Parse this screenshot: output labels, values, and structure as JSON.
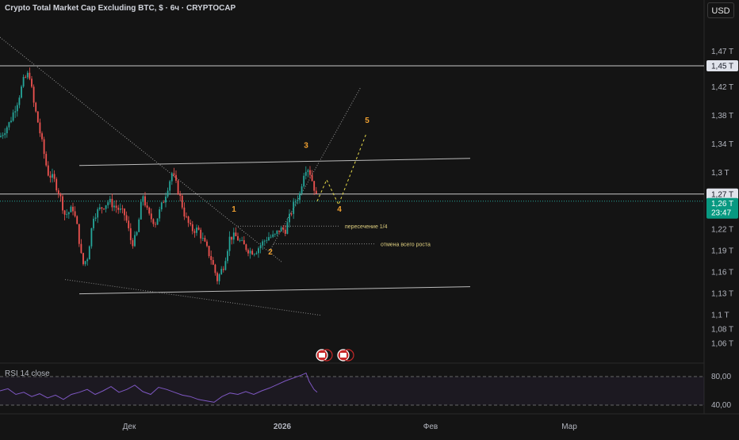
{
  "title": "Crypto Total Market Cap Excluding BTC, $ · 6ч · CRYPTOCAP",
  "currency": "USD",
  "rsi_label": "RSI 14 close",
  "price_badges": {
    "resistance": "1,45 T",
    "level": "1,27 T",
    "last": "1,26 T",
    "countdown": "23:47"
  },
  "annotations": {
    "intersection": "пересечение 1/4",
    "cancel": "отмена всего роста"
  },
  "colors": {
    "background": "#141414",
    "up": "#26a69a",
    "down": "#ef5350",
    "wave": "#f0a030",
    "rsi": "#7e57c2",
    "last_badge": "#089981"
  },
  "chart_data": {
    "type": "candlestick",
    "y_axis": {
      "unit": "T",
      "ylim": [
        1.035,
        1.5
      ],
      "ticks": [
        "1,47 T",
        "1,42 T",
        "1,38 T",
        "1,34 T",
        "1,3 T",
        "1,22 T",
        "1,19 T",
        "1,16 T",
        "1,13 T",
        "1,1 T",
        "1,08 T",
        "1,06 T"
      ],
      "tick_values": [
        1.47,
        1.42,
        1.38,
        1.34,
        1.3,
        1.22,
        1.19,
        1.16,
        1.13,
        1.1,
        1.08,
        1.06
      ]
    },
    "x_axis": {
      "labels": [
        "Дек",
        "2026",
        "Фев",
        "Мар"
      ]
    },
    "close_path": [
      [
        0,
        1.35
      ],
      [
        12,
        1.37
      ],
      [
        22,
        1.4
      ],
      [
        30,
        1.43
      ],
      [
        37,
        1.44
      ],
      [
        42,
        1.4
      ],
      [
        48,
        1.37
      ],
      [
        55,
        1.33
      ],
      [
        60,
        1.3
      ],
      [
        68,
        1.29
      ],
      [
        75,
        1.27
      ],
      [
        82,
        1.24
      ],
      [
        92,
        1.25
      ],
      [
        98,
        1.22
      ],
      [
        104,
        1.17
      ],
      [
        110,
        1.18
      ],
      [
        118,
        1.24
      ],
      [
        127,
        1.25
      ],
      [
        137,
        1.26
      ],
      [
        148,
        1.25
      ],
      [
        158,
        1.24
      ],
      [
        166,
        1.2
      ],
      [
        172,
        1.21
      ],
      [
        180,
        1.27
      ],
      [
        187,
        1.24
      ],
      [
        196,
        1.23
      ],
      [
        206,
        1.26
      ],
      [
        217,
        1.3
      ],
      [
        226,
        1.27
      ],
      [
        233,
        1.24
      ],
      [
        241,
        1.22
      ],
      [
        250,
        1.22
      ],
      [
        258,
        1.2
      ],
      [
        266,
        1.18
      ],
      [
        274,
        1.15
      ],
      [
        282,
        1.17
      ],
      [
        290,
        1.21
      ],
      [
        298,
        1.21
      ],
      [
        305,
        1.2
      ],
      [
        315,
        1.19
      ],
      [
        322,
        1.19
      ],
      [
        330,
        1.2
      ],
      [
        338,
        1.21
      ],
      [
        346,
        1.21
      ],
      [
        352,
        1.22
      ],
      [
        360,
        1.22
      ],
      [
        366,
        1.24
      ],
      [
        372,
        1.26
      ],
      [
        378,
        1.27
      ],
      [
        383,
        1.3
      ],
      [
        387,
        1.31
      ],
      [
        391,
        1.3
      ],
      [
        396,
        1.28
      ],
      [
        400,
        1.26
      ]
    ],
    "levels": {
      "resistance": 1.45,
      "current_level": 1.27,
      "last_price": 1.26,
      "intersection_1_4": 1.225,
      "cancel_all_growth": 1.2
    },
    "channel": {
      "upper": [
        [
          100,
          1.31
        ],
        [
          593,
          1.32
        ]
      ],
      "lower": [
        [
          100,
          1.13
        ],
        [
          593,
          1.14
        ]
      ],
      "lower_wick_line": [
        [
          82,
          1.15
        ],
        [
          404,
          1.1
        ]
      ]
    },
    "trend_lines": [
      {
        "points": [
          [
            0,
            1.49
          ],
          [
            355,
            1.175
          ]
        ],
        "style": "dotted"
      },
      {
        "points": [
          [
            340,
            1.19
          ],
          [
            455,
            1.42
          ]
        ],
        "style": "dotted"
      }
    ],
    "elliott_waves": [
      {
        "label": "1",
        "x": 295,
        "y": 1.245
      },
      {
        "label": "2",
        "x": 341,
        "y": 1.185
      },
      {
        "label": "3",
        "x": 386,
        "y": 1.335
      },
      {
        "label": "4",
        "x": 428,
        "y": 1.245
      },
      {
        "label": "5",
        "x": 463,
        "y": 1.37
      }
    ],
    "projection_path": [
      [
        400,
        1.26
      ],
      [
        412,
        1.29
      ],
      [
        427,
        1.255
      ],
      [
        462,
        1.355
      ]
    ],
    "rsi": {
      "upper": 80,
      "lower": 40,
      "ylim": [
        30,
        90
      ],
      "tick_labels": [
        "80,00",
        "40,00"
      ],
      "values": [
        [
          0,
          60
        ],
        [
          10,
          63
        ],
        [
          20,
          55
        ],
        [
          30,
          58
        ],
        [
          40,
          52
        ],
        [
          50,
          56
        ],
        [
          60,
          50
        ],
        [
          70,
          54
        ],
        [
          80,
          48
        ],
        [
          90,
          55
        ],
        [
          100,
          58
        ],
        [
          110,
          62
        ],
        [
          120,
          55
        ],
        [
          130,
          60
        ],
        [
          140,
          66
        ],
        [
          150,
          58
        ],
        [
          160,
          62
        ],
        [
          170,
          68
        ],
        [
          180,
          59
        ],
        [
          190,
          55
        ],
        [
          200,
          65
        ],
        [
          210,
          62
        ],
        [
          220,
          58
        ],
        [
          230,
          54
        ],
        [
          240,
          52
        ],
        [
          250,
          48
        ],
        [
          260,
          46
        ],
        [
          270,
          44
        ],
        [
          280,
          52
        ],
        [
          290,
          57
        ],
        [
          300,
          55
        ],
        [
          310,
          59
        ],
        [
          320,
          55
        ],
        [
          330,
          60
        ],
        [
          340,
          64
        ],
        [
          350,
          69
        ],
        [
          360,
          74
        ],
        [
          370,
          78
        ],
        [
          380,
          82
        ],
        [
          386,
          85
        ],
        [
          390,
          73
        ],
        [
          396,
          62
        ],
        [
          400,
          58
        ]
      ]
    }
  }
}
